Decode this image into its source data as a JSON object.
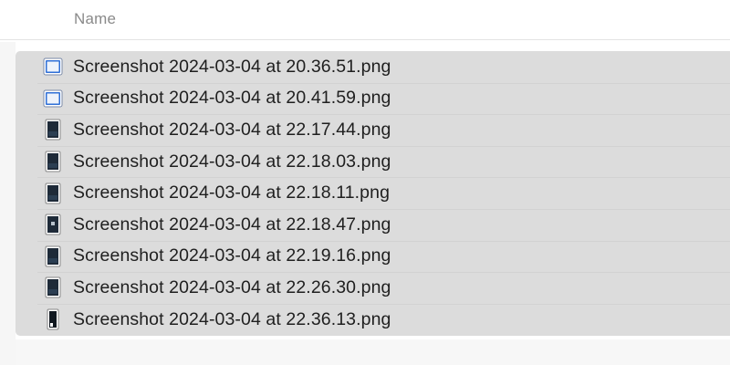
{
  "column_header": {
    "name_label": "Name"
  },
  "files": [
    {
      "name": "Screenshot 2024-03-04 at 20.36.51.png",
      "thumb": "light-window"
    },
    {
      "name": "Screenshot 2024-03-04 at 20.41.59.png",
      "thumb": "light-window"
    },
    {
      "name": "Screenshot 2024-03-04 at 22.17.44.png",
      "thumb": "dark-portrait"
    },
    {
      "name": "Screenshot 2024-03-04 at 22.18.03.png",
      "thumb": "dark-portrait"
    },
    {
      "name": "Screenshot 2024-03-04 at 22.18.11.png",
      "thumb": "dark-portrait"
    },
    {
      "name": "Screenshot 2024-03-04 at 22.18.47.png",
      "thumb": "dark-portrait-center"
    },
    {
      "name": "Screenshot 2024-03-04 at 22.19.16.png",
      "thumb": "dark-portrait"
    },
    {
      "name": "Screenshot 2024-03-04 at 22.26.30.png",
      "thumb": "dark-portrait"
    },
    {
      "name": "Screenshot 2024-03-04 at 22.36.13.png",
      "thumb": "dark-narrow"
    }
  ],
  "colors": {
    "selection": "#dcdcdc",
    "header_text": "#8a8a8a",
    "file_text": "#1f1f1f"
  }
}
